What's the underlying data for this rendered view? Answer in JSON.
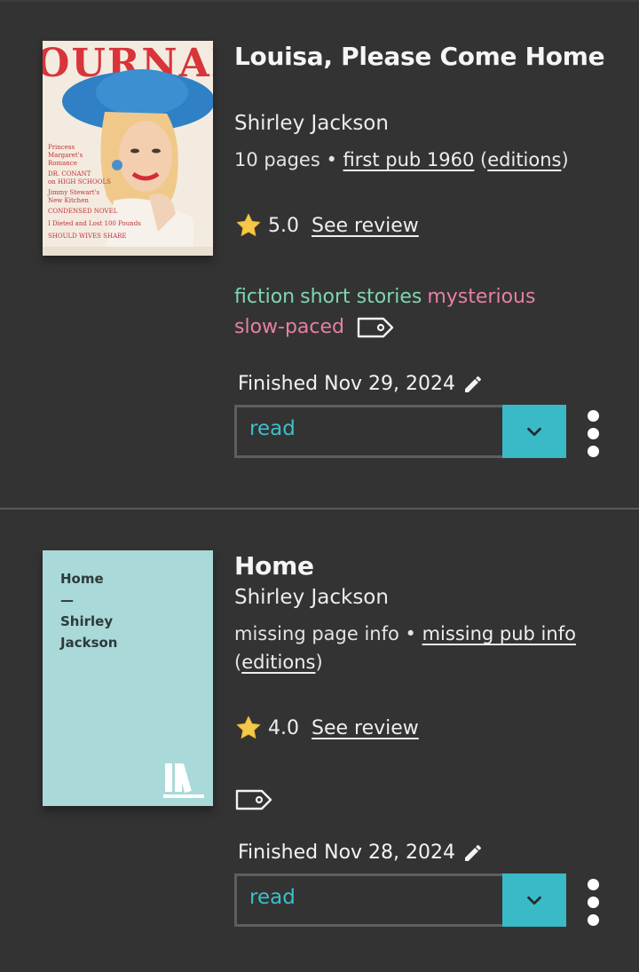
{
  "entries": [
    {
      "title": "Louisa, Please Come Home",
      "author": "Shirley Jackson",
      "pages": "10 pages",
      "first_pub": "first pub 1960",
      "editions": "editions",
      "rating": "5.0",
      "review_link": "See review",
      "tags": [
        {
          "label": "fiction",
          "color": "#7fd6b0"
        },
        {
          "label": "short stories",
          "color": "#7fd6b0"
        },
        {
          "label": "mysterious",
          "color": "#e77fa6"
        },
        {
          "label": "slow-paced",
          "color": "#e77fa6"
        }
      ],
      "finished": "Finished Nov 29, 2024",
      "status": "read",
      "cover_text": "JOURNAL"
    },
    {
      "title": "Home",
      "author": "Shirley Jackson",
      "pages": "missing page info",
      "first_pub": "missing pub info",
      "editions": "editions",
      "rating": "4.0",
      "review_link": "See review",
      "tags": [],
      "finished": "Finished Nov 28, 2024",
      "status": "read",
      "cover_lines": [
        "Home",
        "—",
        "Shirley",
        "Jackson"
      ]
    }
  ],
  "colors": {
    "background": "#333333",
    "accent": "#3ab9c6",
    "tag_green": "#7fd6b0",
    "tag_pink": "#e77fa6",
    "star": "#f6c84a"
  },
  "icons": [
    "star-icon",
    "tag-icon",
    "pencil-icon",
    "chevron-down-icon",
    "kebab-menu-icon",
    "bookshelf-icon"
  ]
}
